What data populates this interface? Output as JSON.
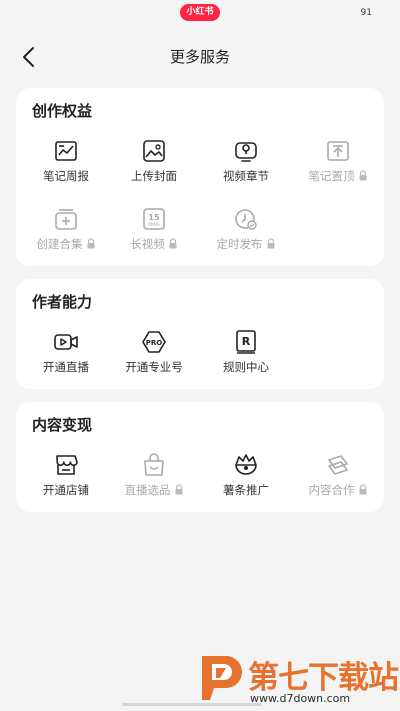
{
  "status_bar": {
    "app_badge": "小红书",
    "battery": "91"
  },
  "nav": {
    "title": "更多服务"
  },
  "sections": [
    {
      "title": "创作权益",
      "items": [
        {
          "label": "笔记周报",
          "icon": "chart-note-icon",
          "locked": false
        },
        {
          "label": "上传封面",
          "icon": "image-icon",
          "locked": false
        },
        {
          "label": "视频章节",
          "icon": "video-chapter-icon",
          "locked": false
        },
        {
          "label": "笔记置顶",
          "icon": "pin-top-icon",
          "locked": true
        },
        {
          "label": "创建合集",
          "icon": "collection-add-icon",
          "locked": true
        },
        {
          "label": "长视频",
          "icon": "long-video-icon",
          "locked": true
        },
        {
          "label": "定时发布",
          "icon": "scheduled-publish-icon",
          "locked": true
        }
      ]
    },
    {
      "title": "作者能力",
      "items": [
        {
          "label": "开通直播",
          "icon": "live-video-icon",
          "locked": false
        },
        {
          "label": "开通专业号",
          "icon": "pro-badge-icon",
          "locked": false
        },
        {
          "label": "规则中心",
          "icon": "rules-icon",
          "locked": false
        }
      ]
    },
    {
      "title": "内容变现",
      "items": [
        {
          "label": "开通店铺",
          "icon": "store-icon",
          "locked": false
        },
        {
          "label": "直播选品",
          "icon": "shopping-bag-icon",
          "locked": true
        },
        {
          "label": "薯条推广",
          "icon": "promotion-icon",
          "locked": false
        },
        {
          "label": "内容合作",
          "icon": "cooperation-icon",
          "locked": true
        }
      ]
    }
  ],
  "watermark": {
    "text": "第七下载站",
    "url": "www.d7down.com"
  },
  "colors": {
    "brand": "#ff2442",
    "active_icon": "#222222",
    "locked": "#a9a9a9",
    "watermark": "#e5732f"
  }
}
